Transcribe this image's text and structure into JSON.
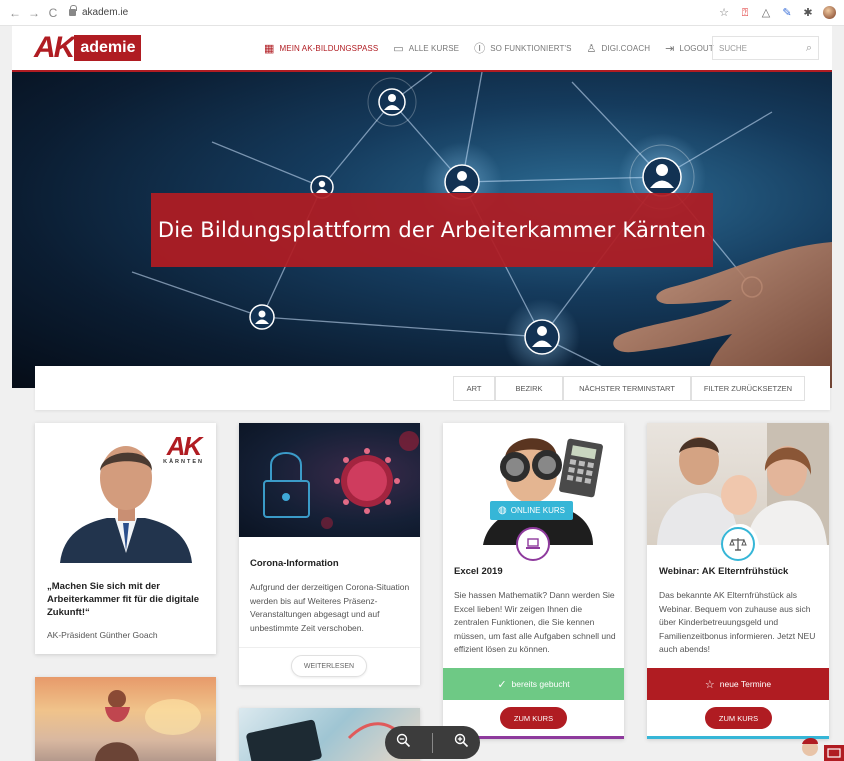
{
  "browser": {
    "back": "←",
    "forward": "→",
    "reload": "C",
    "url": "akadem.ie",
    "extensions": [
      "star-icon",
      "red-extension-icon",
      "drive-icon",
      "pen-extension-icon",
      "pin-icon",
      "profile-avatar"
    ]
  },
  "header": {
    "logo_ak": "AK",
    "logo_text": "ademie",
    "nav": [
      {
        "label": "MEIN AK-BILDUNGSPASS",
        "icon": "grid-icon",
        "active": true
      },
      {
        "label": "ALLE KURSE",
        "icon": "folder-icon"
      },
      {
        "label": "SO FUNKTIONIERT'S",
        "icon": "question-circle-icon"
      },
      {
        "label": "DIGI.COACH",
        "icon": "user-icon"
      },
      {
        "label": "LOGOUT",
        "icon": "logout-icon"
      }
    ],
    "search_placeholder": "SUCHE"
  },
  "hero": {
    "title": "Die Bildungsplattform der Arbeiterkammer Kärnten"
  },
  "filters": [
    "ART",
    "BEZIRK",
    "NÄCHSTER TERMINSTART",
    "FILTER ZURÜCKSETZEN"
  ],
  "cards": [
    {
      "type": "quote",
      "image_logo": "AK",
      "image_logo_sub": "KÄRNTEN",
      "quote": "„Machen Sie sich mit der Arbeiterkammer fit für die digitale Zukunft!“",
      "author": "AK-Präsident Günther Goach"
    },
    {
      "type": "info",
      "title": "Corona-Information",
      "text": "Aufgrund der derzeitigen Corona-Situation werden bis auf Weiteres Präsenz-Veranstaltungen abgesagt und auf unbestimmte Zeit verschoben.",
      "button": "WEITERLESEN"
    },
    {
      "type": "course",
      "badge": "ONLINE KURS",
      "icon": "laptop-icon",
      "title": "Excel 2019",
      "text": "Sie hassen Mathematik? Dann werden Sie Excel lieben! Wir zeigen Ihnen die zentralen Funktionen, die Sie kennen müssen, um fast alle Aufgaben schnell und effizient lösen zu können.",
      "status": "bereits gebucht",
      "status_color": "#6ec985",
      "button": "ZUM KURS"
    },
    {
      "type": "course",
      "icon": "scale-icon",
      "title": "Webinar: AK Elternfrühstück",
      "text": "Das bekannte AK Elternfrühstück als Webinar. Bequem von zuhause aus sich über Kinderbetreuungsgeld und Familienzeitbonus informieren. Jetzt NEU auch abends!",
      "status": "neue Termine",
      "status_color": "#b01c22",
      "button": "ZUM KURS"
    }
  ],
  "zoom": {
    "out": "zoom-out-icon",
    "in": "zoom-in-icon"
  },
  "colors": {
    "brand": "#b01c22",
    "accent_blue": "#36b6d7",
    "booked_green": "#6ec985",
    "purple": "#8e3a9d"
  }
}
